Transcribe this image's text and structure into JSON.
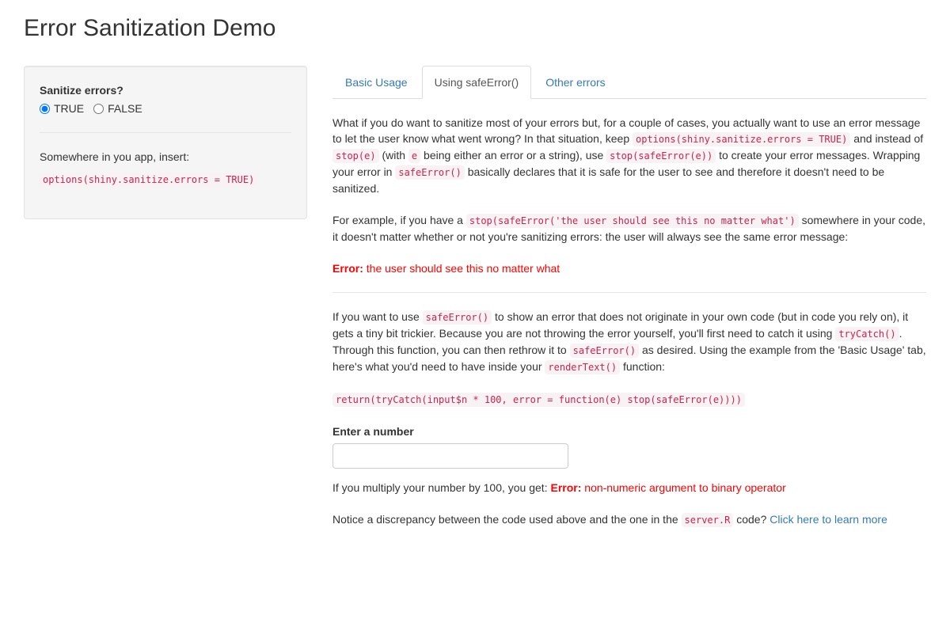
{
  "title": "Error Sanitization Demo",
  "sidebar": {
    "label": "Sanitize errors?",
    "options": [
      "TRUE",
      "FALSE"
    ],
    "selected": "TRUE",
    "insert_text": "Somewhere in you app, insert:",
    "insert_code": "options(shiny.sanitize.errors = TRUE)"
  },
  "tabs": [
    {
      "label": "Basic Usage"
    },
    {
      "label": "Using safeError()",
      "active": true
    },
    {
      "label": "Other errors"
    }
  ],
  "paragraphs": [
    [
      [
        "t",
        "What if you do want to sanitize most of your errors but, for a couple of cases, you actually want to use an error message to let the user know what went wrong? In that situation, keep "
      ],
      [
        "c",
        "options(shiny.sanitize.errors = TRUE)"
      ],
      [
        "t",
        " and instead of "
      ],
      [
        "c",
        "stop(e)"
      ],
      [
        "t",
        " (with "
      ],
      [
        "c",
        "e"
      ],
      [
        "t",
        " being either an error or a string), use "
      ],
      [
        "c",
        "stop(safeError(e))"
      ],
      [
        "t",
        " to create your error messages. Wrapping your error in "
      ],
      [
        "c",
        "safeError()"
      ],
      [
        "t",
        " basically declares that it is safe for the user to see and therefore it doesn't need to be sanitized."
      ]
    ],
    [
      [
        "t",
        "For example, if you have a "
      ],
      [
        "c",
        "stop(safeError('the user should see this no matter what')"
      ],
      [
        "t",
        " somewhere in your code, it doesn't matter whether or not you're sanitizing errors: the user will always see the same error message:"
      ]
    ]
  ],
  "error1": {
    "prefix": "Error:",
    "message": "the user should see this no matter what"
  },
  "paragraphs2": [
    [
      [
        "t",
        "If you want to use "
      ],
      [
        "c",
        "safeError()"
      ],
      [
        "t",
        " to show an error that does not originate in your own code (but in code you rely on), it gets a tiny bit trickier. Because you are not throwing the error yourself, you'll first need to catch it using "
      ],
      [
        "c",
        "tryCatch()"
      ],
      [
        "t",
        ". Through this function, you can then rethrow it to "
      ],
      [
        "c",
        "safeError()"
      ],
      [
        "t",
        " as desired. Using the example from the 'Basic Usage' tab, here's what you'd need to have inside your "
      ],
      [
        "c",
        "renderText()"
      ],
      [
        "t",
        " function:"
      ]
    ],
    [
      [
        "c",
        "return(tryCatch(input$n * 100, error = function(e) stop(safeError(e))))"
      ]
    ]
  ],
  "number_input": {
    "label": "Enter a number",
    "value": ""
  },
  "result": {
    "text": "If you multiply your number by 100, you get: ",
    "prefix": "Error:",
    "message": "non-numeric argument to binary operator"
  },
  "notice": {
    "text": "Notice a discrepancy between the code used above and the one in the ",
    "code": "server.R",
    "text2": " code? ",
    "link": "Click here to learn more"
  }
}
